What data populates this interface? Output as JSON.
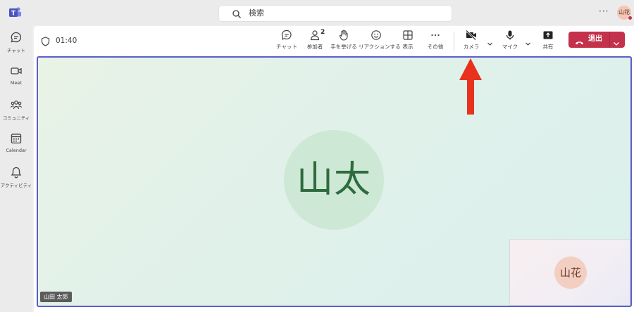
{
  "top": {
    "search_placeholder": "検索",
    "more": "···",
    "avatar_initials": "山花"
  },
  "rail": [
    {
      "label": "チャット",
      "icon": "chat-icon"
    },
    {
      "label": "Meet",
      "icon": "video-icon"
    },
    {
      "label": "コミュニティ",
      "icon": "community-icon"
    },
    {
      "label": "Calendar",
      "icon": "calendar-icon"
    },
    {
      "label": "アクティビティ",
      "icon": "bell-icon"
    }
  ],
  "toolbar": {
    "timer": "01:40",
    "chat": "チャット",
    "participants": "参加者",
    "participants_count": "2",
    "raise_hand": "手を挙げる",
    "react": "リアクションする",
    "view": "表示",
    "more": "その他",
    "camera": "カメラ",
    "mic": "マイク",
    "share": "共有",
    "leave": "退出"
  },
  "stage": {
    "main_initials": "山太",
    "name_tag": "山田 太郎",
    "self_initials": "山花"
  },
  "colors": {
    "accent": "#5b5fc7",
    "leave": "#c4314b",
    "annotation_arrow": "#e8321e"
  }
}
